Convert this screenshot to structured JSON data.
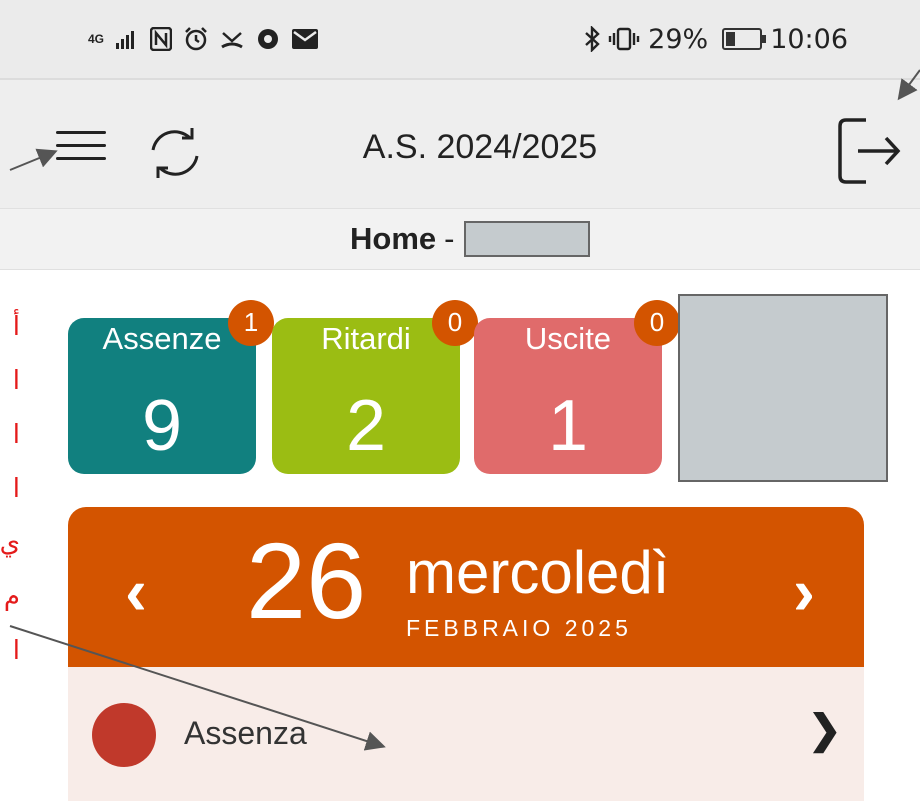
{
  "status_bar": {
    "network": "4G",
    "battery_percent": "29%",
    "battery_level": 0.29,
    "time": "10:06"
  },
  "app_bar": {
    "title": "A.S. 2024/2025"
  },
  "breadcrumb": {
    "page": "Home",
    "separator": "-"
  },
  "tiles": [
    {
      "label": "Assenze",
      "value": "9",
      "badge": "1",
      "color": "#11807f"
    },
    {
      "label": "Ritardi",
      "value": "2",
      "badge": "0",
      "color": "#9bbd13"
    },
    {
      "label": "Uscite",
      "value": "1",
      "badge": "0",
      "color": "#e06b6b"
    }
  ],
  "date_card": {
    "prev_label": "‹",
    "next_label": "›",
    "day": "26",
    "weekday": "mercoledì",
    "month_year": "FEBBRAIO 2025",
    "color": "#d35400"
  },
  "events": [
    {
      "label": "Assenza",
      "chevron": "❯",
      "dot_color": "#c0392b"
    }
  ],
  "side_annotation": {
    "fragments": [
      "أ",
      "ا",
      "ا",
      "ا",
      "ي",
      "م",
      "ا"
    ],
    "color": "#e41a1a"
  }
}
